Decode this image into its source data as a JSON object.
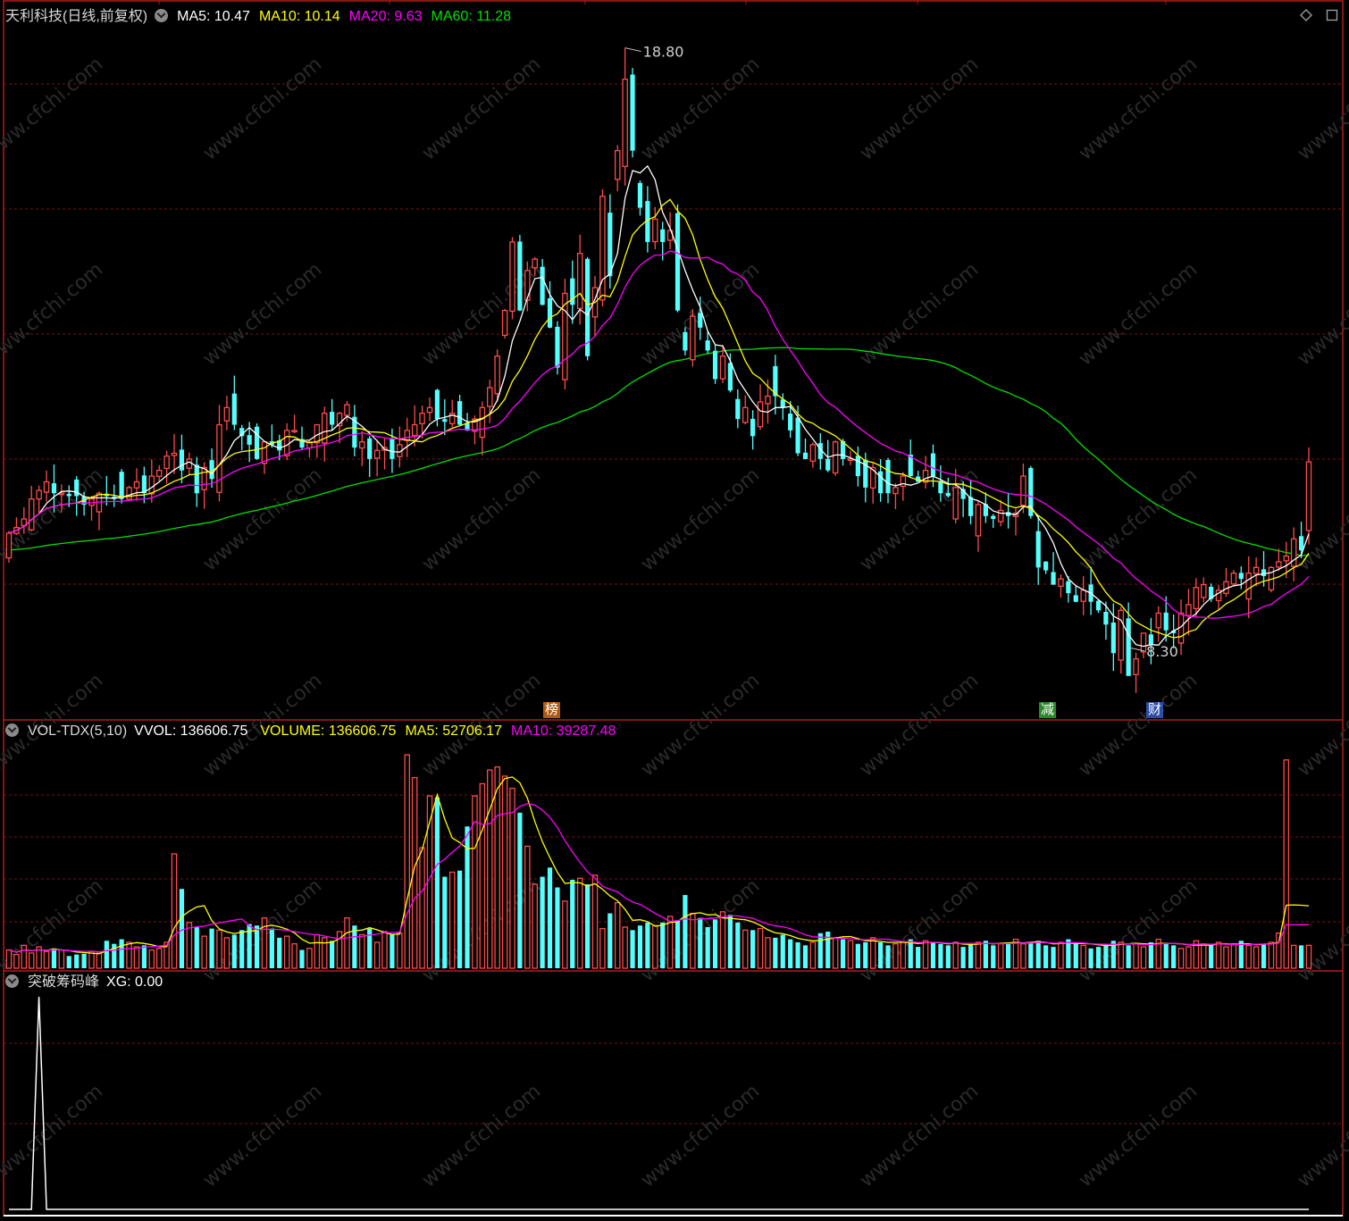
{
  "header": {
    "title": "天利科技(日线,前复权)",
    "ma5_label": "MA5: 10.47",
    "ma10_label": "MA10: 10.14",
    "ma20_label": "MA20: 9.63",
    "ma60_label": "MA60: 11.28"
  },
  "vol_header": {
    "name": "VOL-TDX(5,10)",
    "vvol": "VVOL: 136606.75",
    "volume": "VOLUME: 136606.75",
    "ma5": "MA5: 52706.17",
    "ma10": "MA10: 39287.48"
  },
  "ind_header": {
    "name": "突破筹码峰",
    "xg": "XG: 0.00"
  },
  "markers": {
    "bang": "榜",
    "jian": "减",
    "cai": "财"
  },
  "annotations": {
    "high": "18.80",
    "low": "8.30"
  },
  "colors": {
    "up": "#ff4b4b",
    "down": "#54ffff",
    "ma5": "#ffffff",
    "ma10": "#ffff00",
    "ma20": "#ff00ff",
    "ma60": "#00e000",
    "grid": "#7a1515",
    "frame": "#b01e1e"
  },
  "chart_data": [
    {
      "type": "candlestick",
      "title": "天利科技(日线,前复权)",
      "ylim": [
        7.5,
        19.2
      ],
      "ohlc_first_day": [
        10.17,
        10.45,
        10.1,
        10.3
      ],
      "ohlc_seed": 7,
      "close": [
        10.3,
        10.4,
        10.55,
        10.9,
        11.05,
        11.2,
        11.0,
        11.0,
        10.95,
        10.95,
        10.8,
        10.9,
        11.0,
        10.95,
        10.9,
        10.9,
        11.1,
        11.2,
        11.0,
        11.3,
        11.4,
        11.65,
        11.7,
        11.4,
        11.6,
        11.0,
        11.45,
        11.25,
        12.2,
        12.5,
        12.2,
        12.0,
        11.85,
        11.6,
        11.9,
        11.85,
        11.75,
        12.1,
        12.1,
        11.8,
        11.9,
        12.2,
        12.4,
        12.2,
        12.4,
        12.55,
        11.8,
        11.9,
        11.6,
        11.75,
        11.8,
        11.6,
        11.85,
        12.1,
        12.2,
        12.4,
        12.5,
        12.3,
        12.25,
        12.4,
        12.2,
        12.1,
        12.3,
        12.5,
        12.85,
        13.4,
        14.2,
        15.4,
        14.2,
        14.9,
        15.1,
        14.3,
        13.9,
        13.2,
        14.5,
        14.3,
        15.2,
        13.4,
        14.6,
        16.2,
        14.8,
        17.0,
        18.25,
        17.0,
        16.0,
        15.4,
        15.8,
        15.4,
        15.6,
        14.2,
        13.5,
        14.1,
        13.9,
        13.5,
        13.0,
        13.4,
        12.8,
        12.3,
        12.5,
        12.0,
        12.6,
        12.7,
        12.7,
        12.5,
        12.1,
        11.7,
        11.6,
        11.85,
        11.6,
        11.4,
        11.9,
        11.6,
        11.6,
        11.3,
        11.1,
        11.45,
        11.0,
        11.0,
        11.1,
        11.3,
        11.3,
        11.2,
        11.4,
        11.3,
        11.0,
        10.95,
        11.1,
        10.9,
        10.6,
        10.8,
        10.6,
        10.55,
        10.7,
        10.6,
        10.65,
        11.3,
        10.6,
        9.7,
        9.65,
        9.4,
        9.5,
        9.25,
        9.1,
        9.3,
        9.1,
        8.95,
        8.7,
        8.2,
        8.95,
        7.8,
        8.1,
        8.55,
        8.35,
        8.9,
        8.6,
        8.55,
        8.9,
        9.05,
        9.35,
        9.4,
        9.15,
        9.3,
        9.45,
        9.6,
        9.5,
        9.6,
        9.7,
        9.55,
        9.7,
        9.8,
        9.9,
        10.2,
        10.0,
        11.55
      ],
      "highs_marked": {
        "max": 18.8,
        "min": 8.3
      },
      "ma_lines": [
        "MA5",
        "MA10",
        "MA20",
        "MA60"
      ]
    },
    {
      "type": "bar",
      "title": "VOL-TDX(5,10)",
      "ylim": [
        0,
        140000
      ],
      "last_volume": 136606.75,
      "volumes": [
        12000,
        9000,
        15000,
        10000,
        14000,
        11000,
        13000,
        12000,
        8000,
        9000,
        9500,
        11000,
        10000,
        18000,
        16000,
        19000,
        17000,
        14000,
        15000,
        12000,
        13000,
        17000,
        75000,
        52000,
        30000,
        27000,
        21000,
        26000,
        25000,
        20000,
        22000,
        25000,
        29000,
        28000,
        33000,
        26000,
        20000,
        21000,
        16000,
        12000,
        13000,
        22000,
        20000,
        18000,
        24000,
        33000,
        28000,
        22000,
        26000,
        17000,
        24000,
        22000,
        23000,
        140000,
        125000,
        79000,
        113000,
        112000,
        60000,
        63000,
        64000,
        93000,
        113000,
        121000,
        130000,
        132000,
        126000,
        118000,
        102000,
        80000,
        55000,
        60000,
        66000,
        53000,
        44000,
        58000,
        59000,
        55000,
        61000,
        26000,
        36000,
        43000,
        27000,
        25000,
        28000,
        30000,
        28000,
        30000,
        34000,
        31000,
        48000,
        36000,
        33000,
        27000,
        32000,
        37000,
        35000,
        30000,
        25000,
        25000,
        26000,
        20000,
        20000,
        22000,
        19000,
        17000,
        15000,
        17000,
        23000,
        24000,
        20000,
        19000,
        18000,
        16000,
        17000,
        20000,
        17000,
        15000,
        16000,
        17000,
        19000,
        14000,
        18000,
        17000,
        16000,
        15000,
        17000,
        14000,
        16000,
        17000,
        18000,
        15000,
        16000,
        17000,
        19000,
        16000,
        17000,
        18000,
        15000,
        14000,
        17000,
        19000,
        16000,
        15000,
        13000,
        14000,
        16000,
        18000,
        17000,
        15000,
        16000,
        14000,
        17000,
        19000,
        16000,
        15000,
        13000,
        14000,
        18000,
        16000,
        15000,
        17000,
        14000,
        16000,
        18000,
        15000,
        14000,
        16000,
        17000,
        23000,
        136606.75
      ],
      "ma_lines": [
        "MA5",
        "MA10"
      ]
    },
    {
      "type": "line",
      "title": "突破筹码峰",
      "ylim": [
        0,
        1
      ],
      "xg_peak_index": 4
    }
  ]
}
